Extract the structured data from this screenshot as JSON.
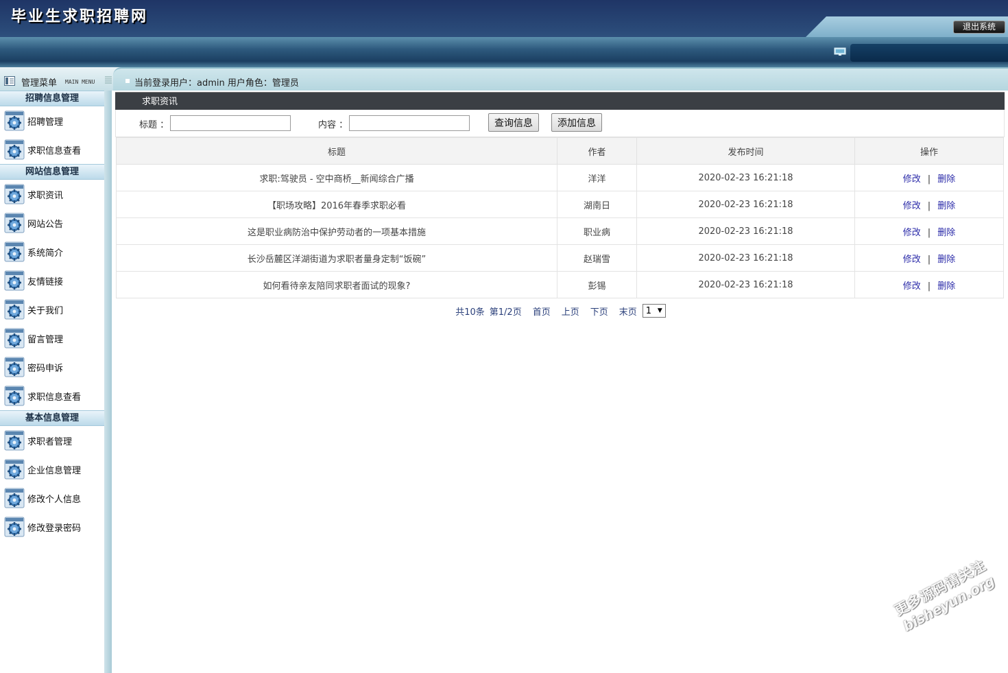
{
  "header": {
    "site_title": "毕业生求职招聘网",
    "logout_label": "退出系统"
  },
  "infobar": {
    "menu_title": "管理菜单",
    "menu_subtitle": "MAIN MENU",
    "user_info": "当前登录用户：admin  用户角色：管理员"
  },
  "sidebar": {
    "groups": [
      {
        "title": "招聘信息管理",
        "items": [
          "招聘管理",
          "求职信息查看"
        ]
      },
      {
        "title": "网站信息管理",
        "items": [
          "求职资讯",
          "网站公告",
          "系统简介",
          "友情链接",
          "关于我们",
          "留言管理",
          "密码申诉",
          "求职信息查看"
        ]
      },
      {
        "title": "基本信息管理",
        "items": [
          "求职者管理",
          "企业信息管理",
          "修改个人信息",
          "修改登录密码"
        ]
      }
    ]
  },
  "main": {
    "section_title": "求职资讯",
    "search": {
      "title_label": "标题 ：",
      "title_value": "",
      "content_label": "内容 ：",
      "content_value": "",
      "query_button": "查询信息",
      "add_button": "添加信息"
    },
    "table": {
      "columns": [
        "标题",
        "作者",
        "发布时间",
        "操作"
      ],
      "edit_label": "修改",
      "delete_label": "删除",
      "separator": "|",
      "rows": [
        {
          "title": "求职:驾驶员 - 空中商桥__新闻综合广播",
          "author": "洋洋",
          "time": "2020-02-23 16:21:18"
        },
        {
          "title": "【职场攻略】2016年春季求职必看",
          "author": "湖南日",
          "time": "2020-02-23 16:21:18"
        },
        {
          "title": "这是职业病防治中保护劳动者的一项基本措施",
          "author": "职业病",
          "time": "2020-02-23 16:21:18"
        },
        {
          "title": "长沙岳麓区洋湖街道为求职者量身定制“饭碗”",
          "author": "赵瑞雪",
          "time": "2020-02-23 16:21:18"
        },
        {
          "title": "如何看待亲友陪同求职者面试的现象?",
          "author": "彭锡",
          "time": "2020-02-23 16:21:18"
        }
      ]
    },
    "pager": {
      "total": "共10条",
      "page_info": "第1/2页",
      "first": "首页",
      "prev": "上页",
      "next": "下页",
      "last": "末页",
      "selected_page": "1"
    }
  },
  "watermark": {
    "line1": "更多源码请关注",
    "line2": "bisheyun.org"
  },
  "colors": {
    "header_dark": "#1f3566",
    "section_bar": "#3b3f44",
    "link": "#2a2aa8",
    "group_header": "#bcdaea"
  },
  "icons": {
    "menu_item": "gear-icon",
    "menu_header": "menu-panel-icon",
    "monitor": "monitor-icon"
  }
}
